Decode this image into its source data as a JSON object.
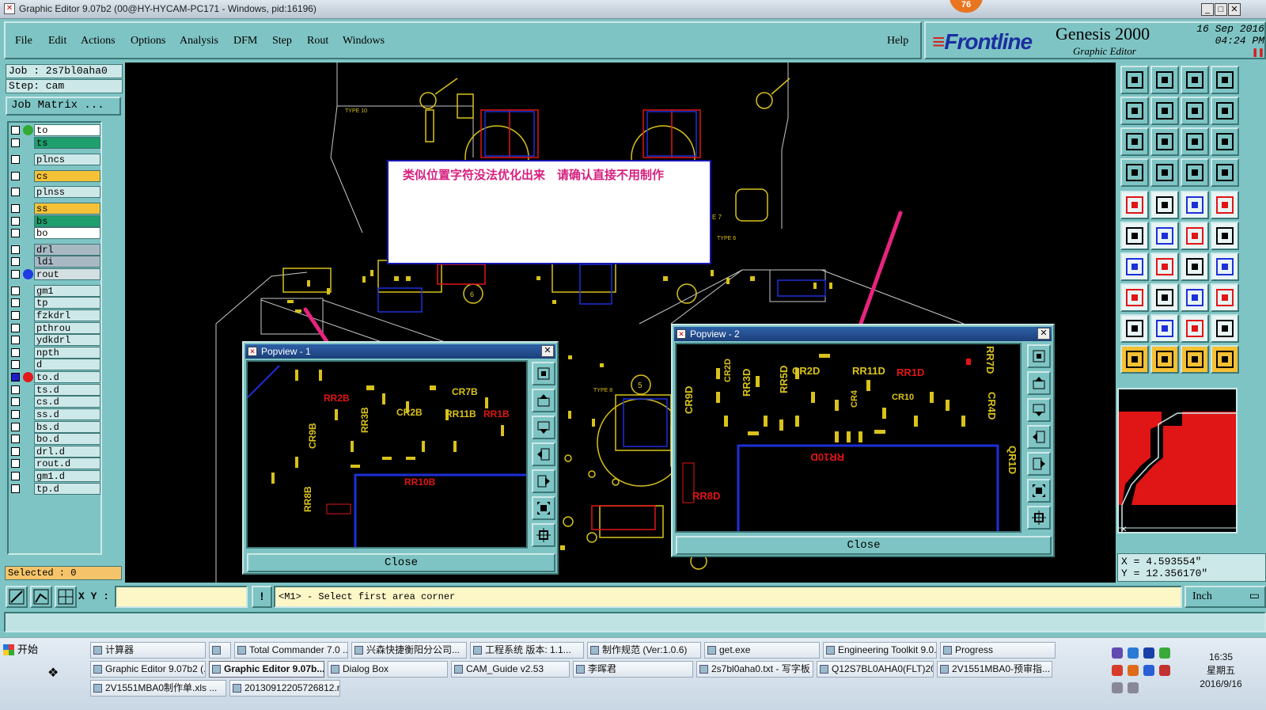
{
  "window": {
    "title": "Graphic Editor 9.07b2 (00@HY-HYCAM-PC171 - Windows, pid:16196)",
    "badge": "76",
    "btn_min": "_",
    "btn_max": "□",
    "btn_close": "✕"
  },
  "menu": {
    "items": [
      "File",
      "Edit",
      "Actions",
      "Options",
      "Analysis",
      "DFM",
      "Step",
      "Rout",
      "Windows"
    ],
    "help": "Help"
  },
  "brand": {
    "logo": "Frontline",
    "product": "Genesis 2000",
    "subtitle": "Graphic Editor",
    "date": "16 Sep 2016",
    "time": "04:24 PM"
  },
  "job": {
    "job_label": "Job : 2s7bl0aha0",
    "step_label": "Step: cam",
    "matrix_button": "Job Matrix ..."
  },
  "layers": [
    {
      "name": "to",
      "bg": "#ffffff",
      "dot": "#33aa33"
    },
    {
      "name": "ts",
      "bg": "#1f9e6e",
      "dot": ""
    },
    {
      "name": "plncs",
      "bg": "#cde8e8",
      "dot": ""
    },
    {
      "name": "cs",
      "bg": "#f5c237",
      "dot": ""
    },
    {
      "name": "plnss",
      "bg": "#cde8e8",
      "dot": ""
    },
    {
      "name": "ss",
      "bg": "#f5c237",
      "dot": ""
    },
    {
      "name": "bs",
      "bg": "#1f9e6e",
      "dot": ""
    },
    {
      "name": "bo",
      "bg": "#ffffff",
      "dot": ""
    },
    {
      "name": "drl",
      "bg": "#a9b9c4",
      "dot": ""
    },
    {
      "name": "ldi",
      "bg": "#a9b9c4",
      "dot": ""
    },
    {
      "name": "rout",
      "bg": "#d4dfe2",
      "dot": "#1d3be0"
    },
    {
      "name": "gm1",
      "bg": "#cde8e8",
      "dot": ""
    },
    {
      "name": "tp",
      "bg": "#cde8e8",
      "dot": ""
    },
    {
      "name": "fzkdrl",
      "bg": "#cde8e8",
      "dot": ""
    },
    {
      "name": "pthrou",
      "bg": "#cde8e8",
      "dot": ""
    },
    {
      "name": "ydkdrl",
      "bg": "#cde8e8",
      "dot": ""
    },
    {
      "name": "npth",
      "bg": "#cde8e8",
      "dot": ""
    },
    {
      "name": "d",
      "bg": "#cde8e8",
      "dot": ""
    },
    {
      "name": "to.d",
      "bg": "#cde8e8",
      "dot": "#e21a1a"
    },
    {
      "name": "ts.d",
      "bg": "#cde8e8",
      "dot": ""
    },
    {
      "name": "cs.d",
      "bg": "#cde8e8",
      "dot": ""
    },
    {
      "name": "ss.d",
      "bg": "#cde8e8",
      "dot": ""
    },
    {
      "name": "bs.d",
      "bg": "#cde8e8",
      "dot": ""
    },
    {
      "name": "bo.d",
      "bg": "#cde8e8",
      "dot": ""
    },
    {
      "name": "drl.d",
      "bg": "#cde8e8",
      "dot": ""
    },
    {
      "name": "rout.d",
      "bg": "#cde8e8",
      "dot": ""
    },
    {
      "name": "gm1.d",
      "bg": "#cde8e8",
      "dot": ""
    },
    {
      "name": "tp.d",
      "bg": "#cde8e8",
      "dot": ""
    }
  ],
  "selected": "Selected : 0",
  "message": "类似位置字符没法优化出来　请确认直接不用制作",
  "canvas_labels": {
    "type10": "TYPE 10",
    "type6": "TYPE 6",
    "type8": "TYPE 8",
    "e7": "E 7",
    "circle5": "5",
    "circle6": "6"
  },
  "popview1": {
    "title": "Popview - 1",
    "close": "Close",
    "labels": [
      "RR2B",
      "CR7B",
      "CR9B",
      "RR3B",
      "CR2B",
      "RR11B",
      "RR1B",
      "RR10B",
      "RR8B"
    ]
  },
  "popview2": {
    "title": "Popview - 2",
    "close": "Close",
    "labels": [
      "CR9D",
      "RR3D",
      "RR5D",
      "CR2D",
      "RR11D",
      "RR1D",
      "CR10",
      "CR4",
      "RR7D",
      "CR4D",
      "RR10D",
      "RR8D",
      "QR1D",
      "CR2D"
    ]
  },
  "coords": {
    "x": "X = 4.593554\"",
    "y": "Y = 12.356170\""
  },
  "bottom": {
    "xy_label": "X Y :",
    "xy_value": "",
    "bang": "!",
    "prompt": "<M1> - Select first area corner",
    "unit": "Inch"
  },
  "taskbar": {
    "start": "开始",
    "row1": [
      "计算器",
      "",
      "Total Commander 7.0 ...",
      "兴森快捷衡阳分公司...",
      "工程系统  版本: 1.1...",
      "制作规范 (Ver:1.0.6)",
      "get.exe",
      "Engineering Toolkit 9.0...",
      "Progress"
    ],
    "row2": [
      "Graphic Editor 9.07b2 (...",
      "Graphic Editor 9.07b...",
      "Dialog Box",
      "CAM_Guide v2.53",
      "李晖君",
      "2s7bl0aha0.txt - 写字板",
      "Q12S7BL0AHA0(FLT)20...",
      "2V1551MBA0-预审指..."
    ],
    "row3": [
      "2V1551MBA0制作单.xls ...",
      "20130912205726812.rtf..."
    ],
    "clock_time": "16:35",
    "clock_day": "星期五",
    "clock_date": "2016/9/16"
  },
  "colors": {
    "panel": "#7fc4c4",
    "accent_pink": "#e8247f",
    "trace_blue": "#1d2fd8",
    "silk_yellow": "#d9c21b",
    "pad_red": "#e01515"
  }
}
